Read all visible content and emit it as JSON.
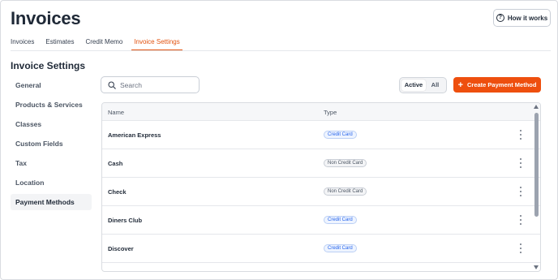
{
  "header": {
    "title": "Invoices",
    "how_it_works": "How it works"
  },
  "tabs": [
    {
      "label": "Invoices",
      "active": false
    },
    {
      "label": "Estimates",
      "active": false
    },
    {
      "label": "Credit Memo",
      "active": false
    },
    {
      "label": "Invoice Settings",
      "active": true
    }
  ],
  "section_title": "Invoice Settings",
  "sidebar": {
    "items": [
      {
        "label": "General"
      },
      {
        "label": "Products & Services"
      },
      {
        "label": "Classes"
      },
      {
        "label": "Custom Fields"
      },
      {
        "label": "Tax"
      },
      {
        "label": "Location"
      },
      {
        "label": "Payment Methods",
        "active": true
      }
    ]
  },
  "search": {
    "placeholder": "Search",
    "value": ""
  },
  "filter": {
    "active_label": "Active",
    "all_label": "All",
    "selected": "Active"
  },
  "create_button": {
    "label": "Create Payment Method"
  },
  "table": {
    "columns": [
      "Name",
      "Type"
    ],
    "rows": [
      {
        "name": "American Express",
        "type": "Credit Card"
      },
      {
        "name": "Cash",
        "type": "Non Credit Card"
      },
      {
        "name": "Check",
        "type": "Non Credit Card"
      },
      {
        "name": "Diners Club",
        "type": "Credit Card"
      },
      {
        "name": "Discover",
        "type": "Credit Card"
      }
    ]
  },
  "colors": {
    "accent": "#ee4f0e",
    "credit_badge": "#2563eb",
    "non_credit_badge": "#4b5563"
  }
}
